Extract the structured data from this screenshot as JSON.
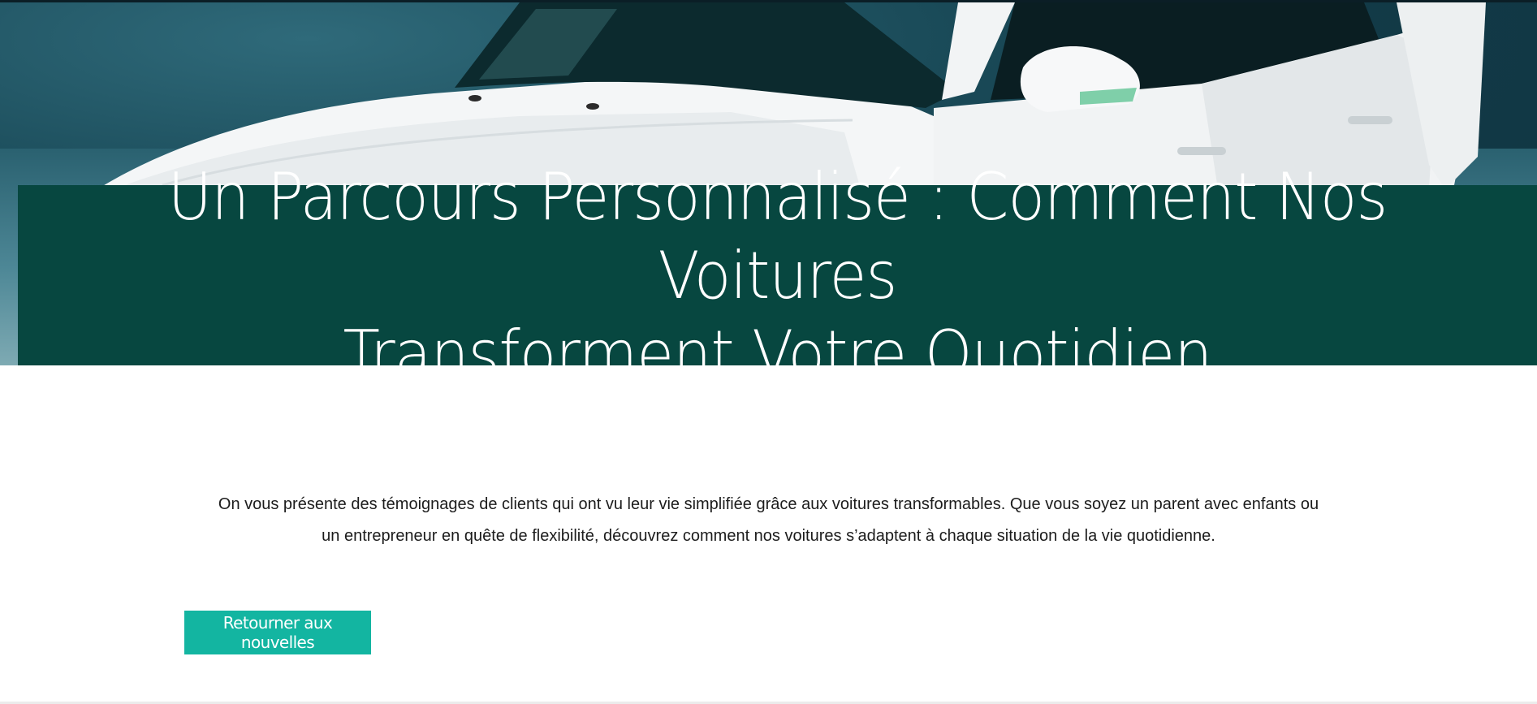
{
  "hero": {
    "title_line_1": "Un Parcours Personnalisé : Comment Nos Voitures",
    "title_line_2": "Transforment Votre Quotidien",
    "image_icon": "white-car-photo",
    "title_background_color": "#074740"
  },
  "article": {
    "intro_line_1": "On vous présente des témoignages de clients qui ont vu leur vie simplifiée grâce aux voitures transformables. Que vous soyez un parent avec enfants ou",
    "intro_line_2": "un entrepreneur en quête de flexibilité, découvrez comment nos voitures s’adaptent à chaque situation de la vie quotidienne."
  },
  "actions": {
    "back_label": "Retourner aux nouvelles",
    "button_color": "#13b5a1"
  }
}
